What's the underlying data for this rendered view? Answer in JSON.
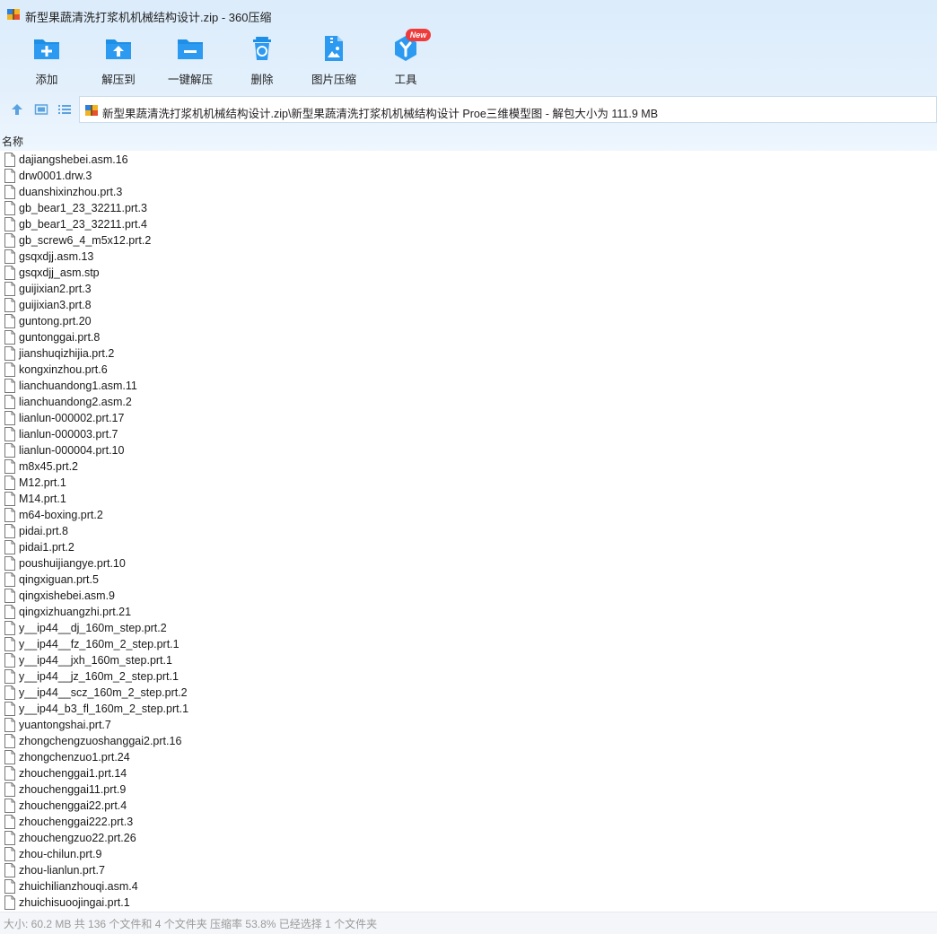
{
  "window": {
    "title": "新型果蔬清洗打浆机机械结构设计.zip - 360压缩"
  },
  "toolbar": {
    "items": [
      {
        "label": "添加",
        "icon": "add-icon"
      },
      {
        "label": "解压到",
        "icon": "extract-to-icon"
      },
      {
        "label": "一键解压",
        "icon": "one-click-extract-icon"
      },
      {
        "label": "删除",
        "icon": "delete-icon"
      },
      {
        "label": "图片压缩",
        "icon": "image-compress-icon"
      },
      {
        "label": "工具",
        "icon": "tools-icon",
        "badge": "New"
      }
    ]
  },
  "address": {
    "path": "新型果蔬清洗打浆机机械结构设计.zip\\新型果蔬清洗打浆机机械结构设计 Proe三维模型图 - 解包大小为 111.9 MB"
  },
  "columns": {
    "name": "名称"
  },
  "files": [
    "dajiangshebei.asm.16",
    "drw0001.drw.3",
    "duanshixinzhou.prt.3",
    "gb_bear1_23_32211.prt.3",
    "gb_bear1_23_32211.prt.4",
    "gb_screw6_4_m5x12.prt.2",
    "gsqxdjj.asm.13",
    "gsqxdjj_asm.stp",
    "guijixian2.prt.3",
    "guijixian3.prt.8",
    "guntong.prt.20",
    "guntonggai.prt.8",
    "jianshuqizhijia.prt.2",
    "kongxinzhou.prt.6",
    "lianchuandong1.asm.11",
    "lianchuandong2.asm.2",
    "lianlun-000002.prt.17",
    "lianlun-000003.prt.7",
    "lianlun-000004.prt.10",
    "m8x45.prt.2",
    "M12.prt.1",
    "M14.prt.1",
    "m64-boxing.prt.2",
    "pidai.prt.8",
    "pidai1.prt.2",
    "poushuijiangye.prt.10",
    "qingxiguan.prt.5",
    "qingxishebei.asm.9",
    "qingxizhuangzhi.prt.21",
    "y__ip44__dj_160m_step.prt.2",
    "y__ip44__fz_160m_2_step.prt.1",
    "y__ip44__jxh_160m_step.prt.1",
    "y__ip44__jz_160m_2_step.prt.1",
    "y__ip44__scz_160m_2_step.prt.2",
    "y__ip44_b3_fl_160m_2_step.prt.1",
    "yuantongshai.prt.7",
    "zhongchengzuoshanggai2.prt.16",
    "zhongchenzuo1.prt.24",
    "zhouchenggai1.prt.14",
    "zhouchenggai11.prt.9",
    "zhouchenggai22.prt.4",
    "zhouchenggai222.prt.3",
    "zhouchengzuo22.prt.26",
    "zhou-chilun.prt.9",
    "zhou-lianlun.prt.7",
    "zhuichilianzhouqi.asm.4",
    "zhuichisuoojingai.prt.1"
  ],
  "status": {
    "text": "大小: 60.2 MB 共 136 个文件和 4 个文件夹 压缩率 53.8% 已经选择 1 个文件夹"
  },
  "colors": {
    "accent": "#1e8fe6",
    "toolbar_bg": "#dcecfb",
    "badge": "#ee3b3b"
  }
}
